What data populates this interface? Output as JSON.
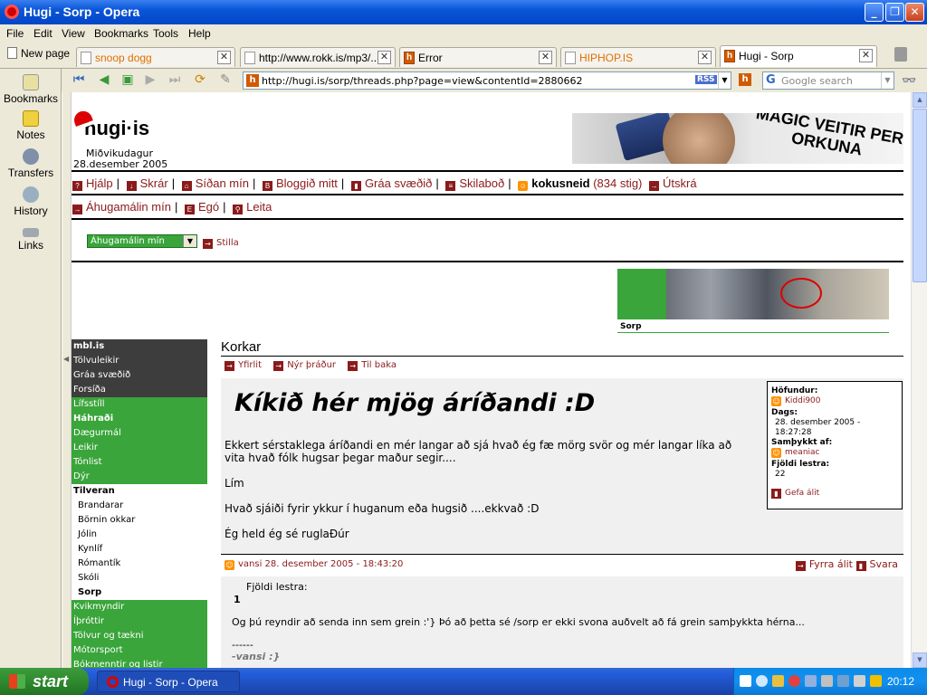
{
  "window": {
    "title": "Hugi - Sorp - Opera"
  },
  "menu": [
    "File",
    "Edit",
    "View",
    "Bookmarks",
    "Tools",
    "Help"
  ],
  "tabs": {
    "new_page": "New page",
    "items": [
      {
        "label": "snoop dogg",
        "style": "orange"
      },
      {
        "label": "http://www.rokk.is/mp3/...",
        "style": "normal"
      },
      {
        "label": "Error",
        "style": "normal"
      },
      {
        "label": "HIPHOP.IS",
        "style": "orange"
      },
      {
        "label": "Hugi - Sorp",
        "style": "active"
      }
    ]
  },
  "address": {
    "url": "http://hugi.is/sorp/threads.php?page=view&contentId=2880662",
    "rss": "RSS",
    "search_placeholder": "Google search"
  },
  "panel": [
    "Bookmarks",
    "Notes",
    "Transfers",
    "History",
    "Links"
  ],
  "site": {
    "logo": "hugi·is",
    "day": "Miðvikudagur",
    "date": "28.desember 2005",
    "ad_text": "MAGIC VEITIR PER ORKUNA",
    "nav1": [
      "Hjálp",
      "Skrár",
      "Síðan mín",
      "Bloggið mitt",
      "Gráa svæðið",
      "Skilaboð"
    ],
    "user": "kokusneid",
    "user_points": "(834 stig)",
    "logout": "Útskrá",
    "nav2": [
      "Áhugamálin mín",
      "Egó",
      "Leita"
    ],
    "select_value": "Áhugamálin mín",
    "stilla": "Stilla",
    "photo_caption": "Sorp"
  },
  "sidebar": [
    {
      "label": "mbl.is",
      "style": "dark",
      "bold": true
    },
    {
      "label": "Tölvuleikir",
      "style": "dark"
    },
    {
      "label": "Gráa svæðið",
      "style": "dark"
    },
    {
      "label": "Forsíða",
      "style": "dark"
    },
    {
      "label": "Lífsstíll",
      "style": "green"
    },
    {
      "label": "Háhraði",
      "style": "green",
      "bold": true
    },
    {
      "label": "Dægurmál",
      "style": "green"
    },
    {
      "label": "Leikir",
      "style": "green"
    },
    {
      "label": "Tónlist",
      "style": "green"
    },
    {
      "label": "Dýr",
      "style": "green"
    },
    {
      "label": "Tilveran",
      "style": "white",
      "bold": true
    },
    {
      "label": "Brandarar",
      "style": "white",
      "sub": true
    },
    {
      "label": "Börnin okkar",
      "style": "white",
      "sub": true
    },
    {
      "label": "Jólin",
      "style": "white",
      "sub": true
    },
    {
      "label": "Kynlíf",
      "style": "white",
      "sub": true
    },
    {
      "label": "Rómantík",
      "style": "white",
      "sub": true
    },
    {
      "label": "Skóli",
      "style": "white",
      "sub": true
    },
    {
      "label": "Sorp",
      "style": "white",
      "sub": true,
      "bold": true
    },
    {
      "label": "Kvikmyndir",
      "style": "green"
    },
    {
      "label": "Íþróttir",
      "style": "green"
    },
    {
      "label": "Tölvur og tækni",
      "style": "green"
    },
    {
      "label": "Mótorsport",
      "style": "green"
    },
    {
      "label": "Bókmenntir og listir",
      "style": "green"
    }
  ],
  "thread": {
    "section": "Korkar",
    "actions": [
      "Yfirlit",
      "Nýr þráður",
      "Til baka"
    ],
    "title": "Kíkið hér mjög áríðandi :D",
    "body": [
      "Ekkert sérstaklega áríðandi en mér langar að sjá hvað ég fæ mörg svör og mér langar líka að vita hvað fólk hugsar þegar maður segir....",
      "Lím",
      "Hvað sjáiði fyrir ykkur í huganum eða hugsið ....ekkvað :D",
      "Ég held ég sé ruglaÐúr"
    ],
    "info": {
      "author_label": "Höfundur:",
      "author": "Kiddi900",
      "date_label": "Dags:",
      "date": "28. desember 2005 - 18:27:28",
      "approved_label": "Samþykkt af:",
      "approved_by": "meaniac",
      "reads_label": "Fjöldi lestra:",
      "reads": "22",
      "rate": "Gefa álit"
    }
  },
  "reply": {
    "header": "vansi 28. desember 2005 - 18:43:20",
    "prev": "Fyrra álit",
    "answer": "Svara",
    "reads_label": "Fjöldi lestra:",
    "reads": "1",
    "text": "Og þú reyndir að senda inn sem grein :'} Þó að þetta sé /sorp er ekki svona auðvelt að fá grein samþykkta hérna...",
    "sig_line": "------",
    "sig": "-vansi :}"
  },
  "taskbar": {
    "start": "start",
    "task": "Hugi - Sorp - Opera",
    "clock": "20:12"
  }
}
